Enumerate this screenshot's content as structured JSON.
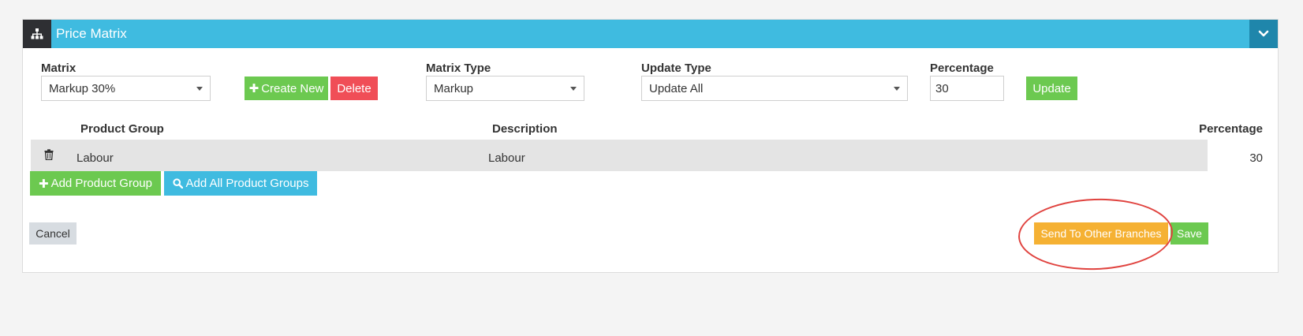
{
  "panel": {
    "title": "Price Matrix",
    "header_icon": "sitemap-icon",
    "collapse_icon": "chevron-down-icon",
    "header_color": "#3fbbe0"
  },
  "form": {
    "matrix_label": "Matrix",
    "matrix_value": "Markup 30%",
    "create_new_label": "Create New",
    "delete_label": "Delete",
    "matrix_type_label": "Matrix Type",
    "matrix_type_value": "Markup",
    "update_type_label": "Update Type",
    "update_type_value": "Update All",
    "percentage_label": "Percentage",
    "percentage_value": "30",
    "update_label": "Update"
  },
  "table": {
    "columns": [
      "Product Group",
      "Description",
      "Percentage"
    ],
    "rows": [
      {
        "product_group": "Labour",
        "description": "Labour",
        "percentage": "30"
      }
    ]
  },
  "actions": {
    "add_product_group_label": "Add Product Group",
    "add_all_product_groups_label": "Add All Product Groups",
    "cancel_label": "Cancel",
    "send_to_other_branches_label": "Send To Other Branches",
    "save_label": "Save"
  },
  "colors": {
    "green": "#6cc950",
    "red": "#f04e57",
    "blue": "#3fbbe0",
    "orange": "#f5b133",
    "annotation": "#e0433f"
  }
}
